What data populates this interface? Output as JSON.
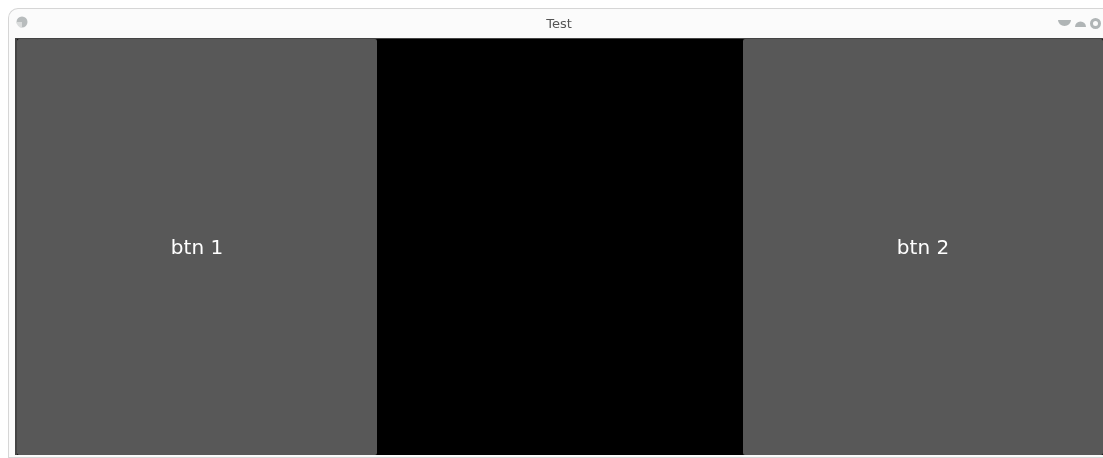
{
  "window": {
    "title": "Test"
  },
  "buttons": [
    {
      "label": "btn 1"
    },
    {
      "label": "btn 2"
    }
  ]
}
